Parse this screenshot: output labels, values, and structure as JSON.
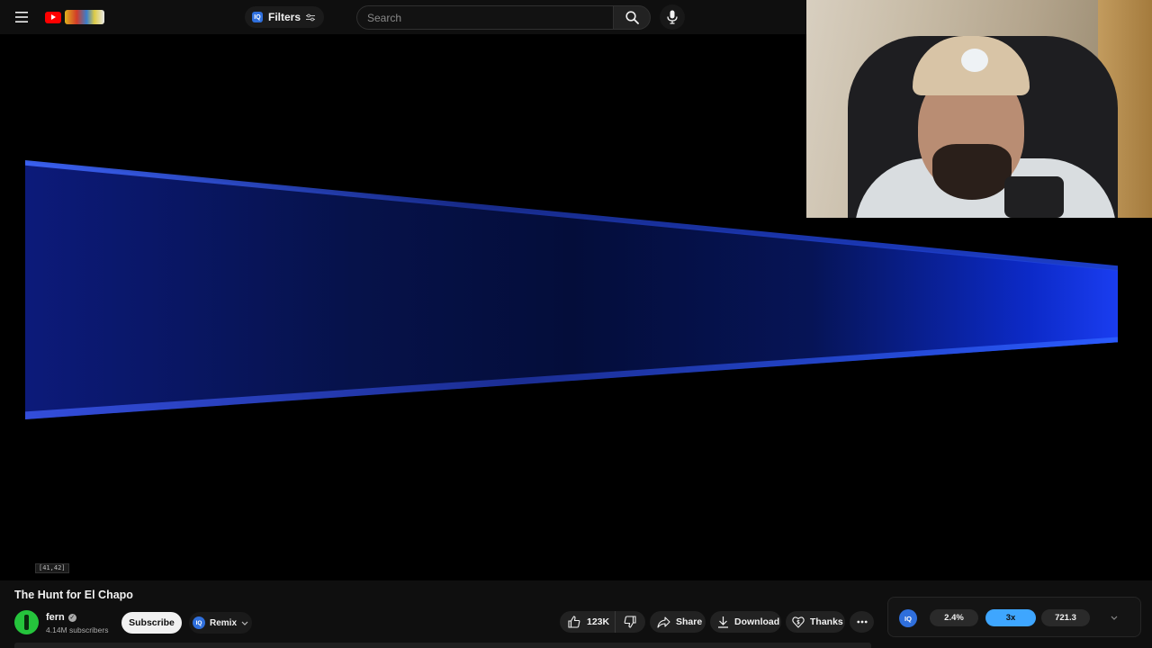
{
  "header": {
    "filters_label": "Filters",
    "search_placeholder": "Search",
    "iq_badge": "IQ"
  },
  "player": {
    "coord_readout": "[41,42]"
  },
  "video": {
    "title": "The Hunt for El Chapo",
    "channel_name": "fern",
    "verified_glyph": "✓",
    "subscribers": "4.14M subscribers",
    "subscribe_label": "Subscribe",
    "remix_label": "Remix",
    "remix_badge": "IQ"
  },
  "actions": {
    "like_count": "123K",
    "share_label": "Share",
    "download_label": "Download",
    "thanks_label": "Thanks"
  },
  "extension": {
    "logo": "IQ",
    "chip_1": "2.4%",
    "chip_2": "3x",
    "chip_3": "721.3"
  },
  "icons": {
    "menu": "hamburger-icon",
    "search": "search-icon",
    "mic": "mic-icon",
    "like": "thumbs-up-icon",
    "dislike": "thumbs-down-icon",
    "share": "share-arrow-icon",
    "download": "download-icon",
    "thanks": "heart-dollar-icon",
    "more": "more-horizontal-icon"
  },
  "colors": {
    "accent_blue": "#3ea6ff",
    "brand_red": "#ff0000",
    "background": "#0f0f0f",
    "iq_blue": "#2f6fdc"
  }
}
